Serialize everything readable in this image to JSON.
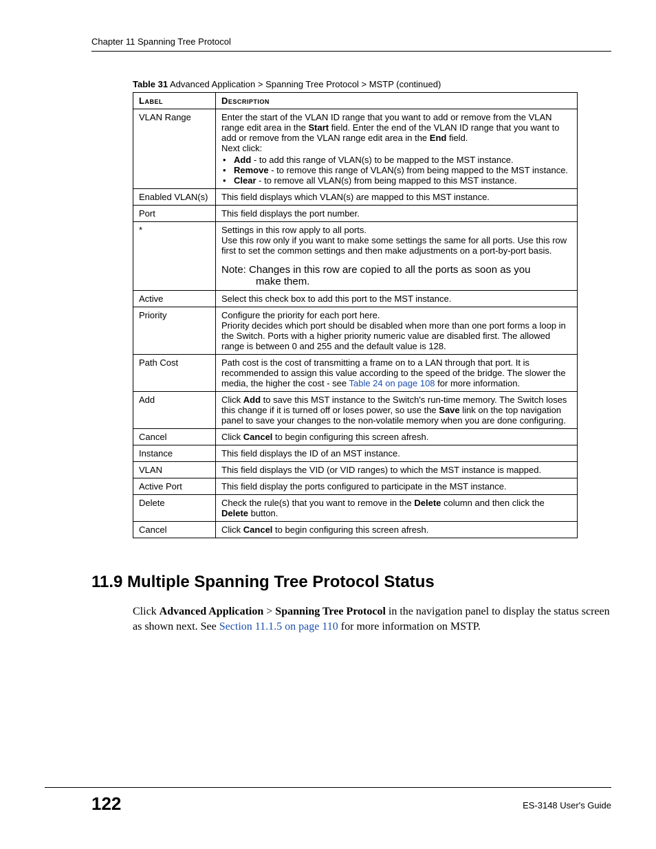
{
  "header": {
    "chapter_line": "Chapter 11 Spanning Tree Protocol"
  },
  "table": {
    "caption_number": "Table 31",
    "caption_text": "   Advanced Application > Spanning Tree Protocol > MSTP  (continued)",
    "head_label": "Label",
    "head_desc": "Description",
    "rows": {
      "vlan_range": {
        "label": "VLAN Range",
        "para_prefix": "Enter the start of the VLAN ID range that you want to add or remove from the VLAN range edit area in the ",
        "start_bold": "Start",
        "para_mid": " field. Enter the end of the VLAN ID range that you want to add or remove from the VLAN range edit area in the ",
        "end_bold": "End",
        "para_suffix": " field.",
        "next_click": "Next click:",
        "b_add_bold": "Add",
        "b_add_text": " - to add this range of VLAN(s) to be mapped to the MST instance.",
        "b_remove_bold": "Remove",
        "b_remove_text": " - to remove this range of VLAN(s) from being mapped to the MST instance.",
        "b_clear_bold": "Clear",
        "b_clear_text": " - to remove all VLAN(s) from being mapped to this MST instance."
      },
      "enabled_vlans": {
        "label": "Enabled VLAN(s)",
        "desc": "This field displays which VLAN(s) are mapped to this MST instance."
      },
      "port": {
        "label": "Port",
        "desc": "This field displays the port number."
      },
      "star": {
        "label": "*",
        "line1": "Settings in this row apply to all ports.",
        "line2": "Use this row only if you want to make some settings the same for all ports. Use this row first to set the common settings and then make adjustments on a port-by-port basis.",
        "note1": "Note: Changes in this row are copied to all the ports as soon as you",
        "note2": "make them."
      },
      "active": {
        "label": "Active",
        "desc": "Select this check box to add this port to the MST instance."
      },
      "priority": {
        "label": "Priority",
        "line1": "Configure the priority for each port here.",
        "line2": "Priority decides which port should be disabled when more than one port forms a loop in the Switch. Ports with a higher priority numeric value are disabled first. The allowed range is between 0 and 255 and the default value is 128."
      },
      "path_cost": {
        "label": "Path Cost",
        "prefix": "Path cost is the cost of transmitting a frame on to a LAN through that port. It is recommended to assign this value according to the speed of the bridge. The slower the media, the higher the cost - see ",
        "link": "Table 24 on page 108",
        "suffix": " for more information."
      },
      "add": {
        "label": "Add",
        "prefix": "Click ",
        "bold1": "Add",
        "mid": " to save this MST instance to the Switch's run-time memory. The Switch loses this change if it is turned off or loses power, so use the ",
        "bold2": "Save",
        "suffix": " link on the top navigation panel to save your changes to the non-volatile memory when you are done configuring."
      },
      "cancel1": {
        "label": "Cancel",
        "prefix": "Click ",
        "bold": "Cancel",
        "suffix": " to begin configuring this screen afresh."
      },
      "instance": {
        "label": "Instance",
        "desc": "This field displays the ID of an MST instance."
      },
      "vlan": {
        "label": "VLAN",
        "desc": "This field displays the VID (or VID ranges) to which the MST instance is mapped."
      },
      "active_port": {
        "label": "Active Port",
        "desc": "This field display the ports configured to participate in the MST instance."
      },
      "delete": {
        "label": "Delete",
        "prefix": "Check the rule(s) that you want to remove in the ",
        "bold1": "Delete",
        "mid": " column and then click the ",
        "bold2": "Delete",
        "suffix": " button."
      },
      "cancel2": {
        "label": "Cancel",
        "prefix": "Click ",
        "bold": "Cancel",
        "suffix": " to begin configuring this screen afresh."
      }
    }
  },
  "section": {
    "heading": "11.9  Multiple Spanning Tree Protocol Status",
    "p_prefix": "Click ",
    "p_bold1": "Advanced Application",
    "p_gt": " > ",
    "p_bold2": "Spanning Tree Protocol",
    "p_mid": " in the navigation panel to display the status screen as shown next. See ",
    "p_link": "Section 11.1.5 on page 110",
    "p_suffix": " for more information on MSTP."
  },
  "footer": {
    "page_number": "122",
    "guide": "ES-3148 User's Guide"
  }
}
